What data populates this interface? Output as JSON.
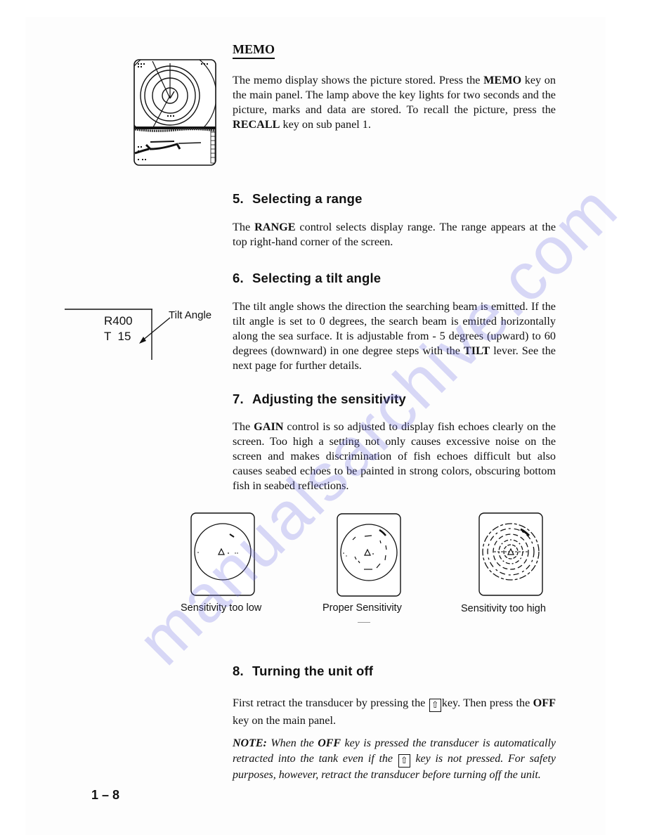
{
  "memo": {
    "title": "MEMO",
    "text_parts": [
      "The memo display shows the picture stored. Press the ",
      "MEMO",
      " key on the main panel. The lamp above the key lights for two seconds and the picture, marks and data are stored. To recall the picture, press the ",
      "RECALL",
      " key on sub panel 1."
    ],
    "figure_icon": "memo-display-icon"
  },
  "section5": {
    "number": "5.",
    "title": "Selecting a range",
    "text_parts": [
      "The ",
      "RANGE",
      " control selects display range. The range appears at the top right-hand corner of the screen."
    ]
  },
  "section6": {
    "number": "6.",
    "title": "Selecting a tilt angle",
    "text_parts": [
      "The tilt angle shows the direction the searching beam is emitted. If the tilt angle is set to 0 degrees, the search beam is emitted horizontally along the sea surface. It is adjustable from - 5 degrees (upward) to 60 degrees (downward) in one degree steps with the ",
      "TILT",
      " lever. See the next page for further details."
    ],
    "figure": {
      "range_readout": "R400",
      "tilt_readout": "T  15",
      "callout": "Tilt Angle"
    }
  },
  "section7": {
    "number": "7.",
    "title": "Adjusting the sensitivity",
    "text_parts": [
      "The ",
      "GAIN",
      " control is so adjusted to display fish echoes clearly on the screen. Too high a setting not only causes excessive noise on the screen and makes discrimination of fish echoes difficult but also  causes seabed echoes to be painted in strong colors, obscuring bottom fish in seabed reflections."
    ],
    "figures": [
      {
        "caption": "Sensitivity too low",
        "icon": "sonar-low-sensitivity-icon"
      },
      {
        "caption": "Proper Sensitivity",
        "icon": "sonar-proper-sensitivity-icon"
      },
      {
        "caption": "Sensitivity too high",
        "icon": "sonar-high-sensitivity-icon"
      }
    ]
  },
  "section8": {
    "number": "8.",
    "title": "Turning the unit off",
    "text_parts": [
      "First retract the transducer by pressing the ",
      "⇧",
      "key. Then press the ",
      "OFF",
      " key on the main panel."
    ],
    "note_parts": [
      "NOTE:",
      " When the ",
      "OFF",
      " key is pressed the transducer is automatically retracted into the tank even if the ",
      "⇧",
      " key is not pressed. For safety purposes, however, retract the transducer before turning off the unit."
    ]
  },
  "footer": {
    "page_number": "1 – 8"
  },
  "watermark": "manualsarchive.com",
  "colors": {
    "ink": "#111111",
    "watermark": "#7878e6"
  }
}
